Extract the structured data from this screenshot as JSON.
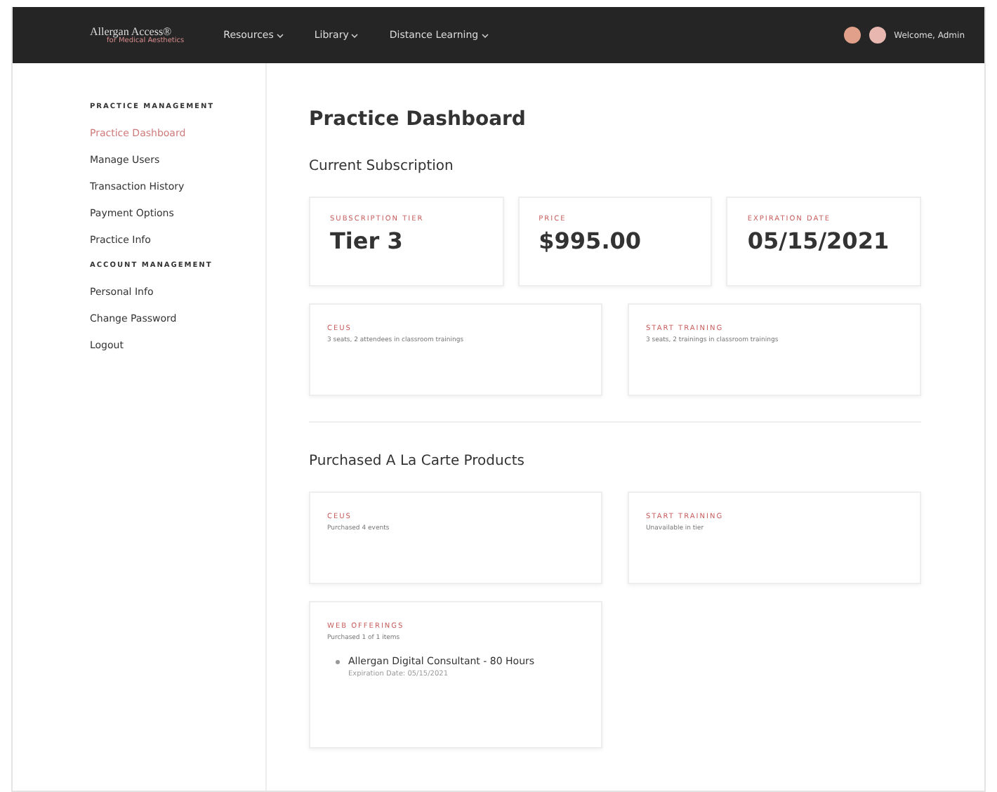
{
  "header": {
    "logo": {
      "title": "Allergan Access®",
      "subtitle": "for Medical Aesthetics"
    },
    "nav": [
      {
        "label": "Resources"
      },
      {
        "label": "Library"
      },
      {
        "label": "Distance Learning"
      }
    ],
    "user": {
      "name": "Welcome, Admin"
    }
  },
  "sidebar": {
    "sections": [
      {
        "title": "PRACTICE MANAGEMENT",
        "items": [
          {
            "label": "Practice Dashboard",
            "selected": true
          },
          {
            "label": "Manage Users",
            "selected": false
          },
          {
            "label": "Transaction History",
            "selected": false
          },
          {
            "label": "Payment Options",
            "selected": false
          },
          {
            "label": "Practice Info",
            "selected": false
          }
        ]
      },
      {
        "title": "ACCOUNT MANAGEMENT",
        "items": [
          {
            "label": "Personal Info",
            "selected": false
          },
          {
            "label": "Change Password",
            "selected": false
          },
          {
            "label": "Logout",
            "selected": false
          }
        ]
      }
    ]
  },
  "main": {
    "title": "Practice Dashboard",
    "subscription": {
      "heading": "Current Subscription",
      "stats": [
        {
          "label": "SUBSCRIPTION TIER",
          "value": "Tier 3"
        },
        {
          "label": "PRICE",
          "value": "$995.00"
        },
        {
          "label": "EXPIRATION DATE",
          "value": "05/15/2021"
        }
      ],
      "cards": [
        {
          "label": "CEUS",
          "text": "3 seats, 2 attendees in classroom trainings"
        },
        {
          "label": "START TRAINING",
          "text": "3 seats, 2 trainings in classroom trainings"
        }
      ]
    },
    "purchased": {
      "heading": "Purchased A La Carte Products",
      "cards": [
        {
          "label": "CEUS",
          "text": "Purchased 4 events"
        },
        {
          "label": "START TRAINING",
          "text": "Unavailable in tier"
        },
        {
          "label": "WEB OFFERINGS",
          "text": "Purchased 1 of 1 items",
          "items": [
            {
              "name": "Allergan Digital Consultant - 80 Hours",
              "expiry": "Expiration Date: 05/15/2021"
            }
          ]
        }
      ]
    }
  }
}
